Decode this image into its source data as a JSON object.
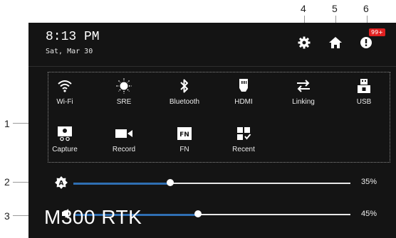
{
  "callouts": {
    "c1": "1",
    "c2": "2",
    "c3": "3",
    "c4": "4",
    "c5": "5",
    "c6": "6"
  },
  "status": {
    "time": "8:13 PM",
    "date": "Sat, Mar 30"
  },
  "top_icons": {
    "settings": "gear-icon",
    "home": "home-icon",
    "notifications": "alert-icon",
    "badge": "99+"
  },
  "tiles": {
    "wifi": "Wi-Fi",
    "sre": "SRE",
    "bluetooth": "Bluetooth",
    "hdmi": "HDMI",
    "linking": "Linking",
    "usb": "USB",
    "capture": "Capture",
    "record": "Record",
    "fn": "FN",
    "recent": "Recent"
  },
  "sliders": {
    "brightness": {
      "value": 0.35,
      "label": "35%"
    },
    "volume": {
      "value": 0.45,
      "label": "45%"
    }
  },
  "watermark": "M300 RTK",
  "colors": {
    "panel": "#141414",
    "accent": "#2f6fb3",
    "badge": "#e02020"
  }
}
